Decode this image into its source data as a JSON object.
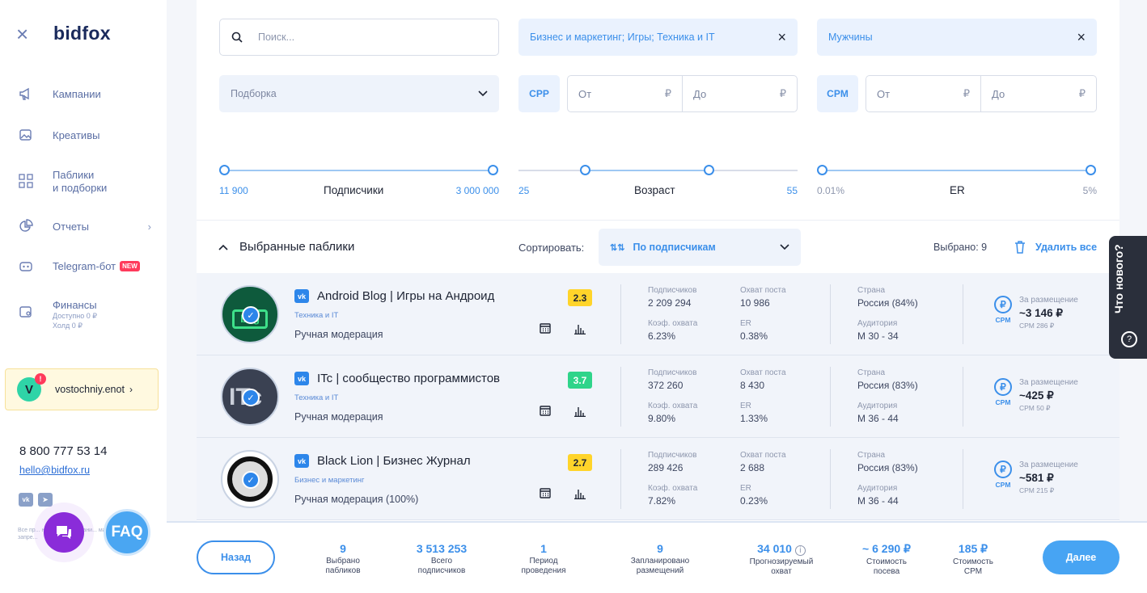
{
  "sidebar": {
    "logo": "bidfox",
    "nav": [
      {
        "label": "Кампании"
      },
      {
        "label": "Креативы"
      },
      {
        "label": "Паблики\nи подборки"
      },
      {
        "label": "Отчеты"
      },
      {
        "label": "Telegram-бот",
        "badge": "NEW"
      },
      {
        "label": "Финансы",
        "sub1": "Доступно 0 ₽",
        "sub2": "Холд 0 ₽"
      }
    ],
    "user": {
      "initial": "V",
      "name": "vostochniy.enot",
      "alert": "!"
    },
    "phone": "8 800 777 53 14",
    "email": "hello@bidfox.ru",
    "fine_print": "Все пр... ны. Незак... ровани... матери... ата запре...",
    "faq": "FAQ"
  },
  "filters": {
    "search_placeholder": "Поиск...",
    "categories": "Бизнес и маркетинг; Игры; Техника и IT",
    "gender": "Мужчины",
    "collection_placeholder": "Подборка",
    "cpp_label": "CPP",
    "cpm_label": "CPM",
    "from": "От",
    "to": "До",
    "currency": "₽"
  },
  "sliders": [
    {
      "title": "Подписчики",
      "min": "11 900",
      "max": "3 000 000"
    },
    {
      "title": "Возраст",
      "min": "25",
      "max": "55"
    },
    {
      "title": "ER",
      "min": "0.01%",
      "max": "5%"
    }
  ],
  "selection": {
    "title": "Выбранные паблики",
    "sort_label": "Сортировать:",
    "sort_value": "По подписчикам",
    "selected": "Выбрано: 9",
    "delete_all": "Удалить все"
  },
  "labels": {
    "subscribers": "Подписчиков",
    "reach": "Охват поста",
    "coef": "Коэф. охвата",
    "er": "ER",
    "country": "Страна",
    "audience": "Аудитория",
    "placement": "За размещение",
    "cpm": "CPM"
  },
  "publics": [
    {
      "name": "Android Blog | Игры на Андроид",
      "category": "Техника и IT",
      "moderation": "Ручная модерация",
      "score": "2.3",
      "score_color": "#ffd42a",
      "subscribers": "2 209 294",
      "reach": "10 986",
      "coef": "6.23%",
      "er": "0.38%",
      "country": "Россия (84%)",
      "audience": "М 30 - 34",
      "price": "~3 146 ₽",
      "cpm": "CPM 286 ₽"
    },
    {
      "name": "ITc | сообщество программистов",
      "category": "Техника и IT",
      "moderation": "Ручная модерация",
      "score": "3.7",
      "score_color": "#2fd48a",
      "subscribers": "372 260",
      "reach": "8 430",
      "coef": "9.80%",
      "er": "1.33%",
      "country": "Россия (83%)",
      "audience": "М 36 - 44",
      "price": "~425 ₽",
      "cpm": "CPM 50 ₽"
    },
    {
      "name": "Black Lion | Бизнес Журнал",
      "category": "Бизнес и маркетинг",
      "moderation": "Ручная модерация (100%)",
      "score": "2.7",
      "score_color": "#ffd42a",
      "subscribers": "289 426",
      "reach": "2 688",
      "coef": "7.82%",
      "er": "0.23%",
      "country": "Россия (83%)",
      "audience": "М 36 - 44",
      "price": "~581 ₽",
      "cpm": "CPM 215 ₽"
    }
  ],
  "footer": {
    "back": "Назад",
    "next": "Далее",
    "stats": [
      {
        "value": "9",
        "label": "Выбрано\nпабликов"
      },
      {
        "value": "3 513 253",
        "label": "Всего\nподписчиков"
      },
      {
        "value": "1",
        "label": "Период\nпроведения"
      },
      {
        "value": "9",
        "label": "Запланировано\nразмещений"
      },
      {
        "value": "34 010",
        "label": "Прогнозируемый\nохват"
      },
      {
        "value": "~ 6 290 ₽",
        "label": "Стоимость\nпосева"
      },
      {
        "value": "185 ₽",
        "label": "Стоимость\nCPM"
      }
    ]
  },
  "whats_new": "Что нового?"
}
